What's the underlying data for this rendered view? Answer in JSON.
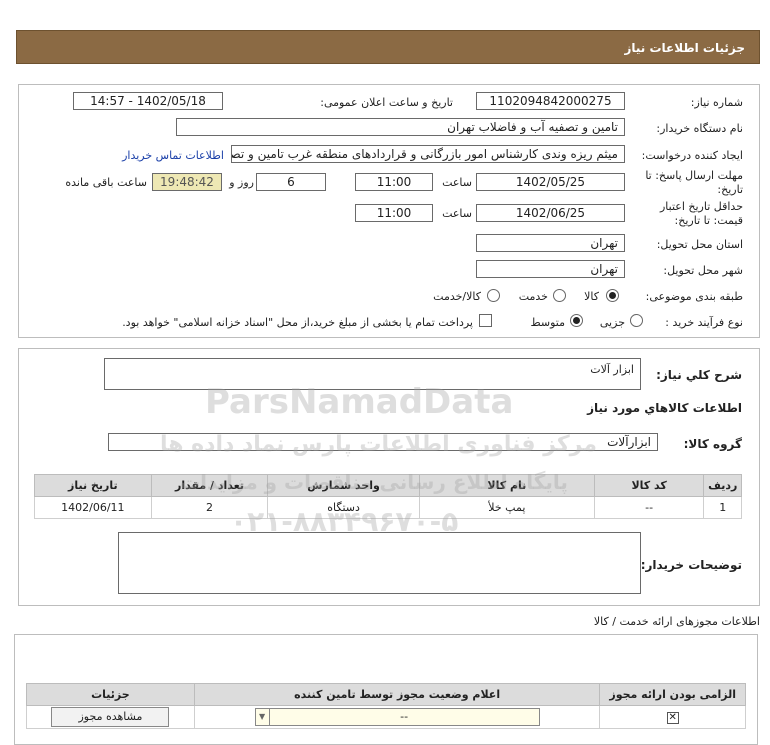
{
  "header": {
    "title": "جزئیات اطلاعات نیاز"
  },
  "form": {
    "need_number_label": "شماره نیاز:",
    "need_number": "1102094842000275",
    "announce_label": "تاریخ و ساعت اعلان عمومی:",
    "announce_value": "1402/05/18 - 14:57",
    "buyer_org_label": "نام دستگاه خریدار:",
    "buyer_org": "تامین و تصفیه آب و فاضلاب تهران",
    "creator_label": "ایجاد کننده درخواست:",
    "creator": "میثم ریزه وندی کارشناس امور بازرگانی و قراردادهای منطقه غرب تامین و تصفیه",
    "contact_link": "اطلاعات تماس خریدار",
    "deadline_label_1": "مهلت ارسال پاسخ: تا",
    "deadline_label_2": "تاریخ:",
    "deadline_date": "1402/05/25",
    "time_label": "ساعت",
    "deadline_time": "11:00",
    "days_value": "6",
    "days_label": "روز و",
    "remaining_time": "19:48:42",
    "remaining_label": "ساعت باقی مانده",
    "validity_label_1": "حداقل تاریخ اعتبار",
    "validity_label_2": "قیمت: تا تاریخ:",
    "validity_date": "1402/06/25",
    "validity_time": "11:00",
    "province_label": "استان محل تحویل:",
    "province": "تهران",
    "city_label": "شهر محل تحویل:",
    "city": "تهران",
    "category_label": "طبقه بندی موضوعی:",
    "category_options": [
      "کالا",
      "خدمت",
      "کالا/خدمت"
    ],
    "category_selected": "کالا",
    "process_label": "نوع فرآیند خرید :",
    "process_options": [
      "جزیی",
      "متوسط"
    ],
    "process_selected": "متوسط",
    "payment_note": "پرداخت تمام یا بخشی از مبلغ خرید،از محل \"اسناد خزانه اسلامی\" خواهد بود."
  },
  "needs": {
    "summary_label": "شرح کلي نياز:",
    "summary": "ابزار آلات",
    "goods_info_title": "اطلاعات کالاهاي مورد نياز",
    "goods_group_label": "گروه کالا:",
    "goods_group": "ابزارآلات",
    "table_headers": [
      "ردیف",
      "کد کالا",
      "نام کالا",
      "واحد شمارش",
      "تعداد / مقدار",
      "تاریخ نیاز"
    ],
    "rows": [
      [
        "1",
        "--",
        "پمپ خلأ",
        "دستگاه",
        "2",
        "1402/06/11"
      ]
    ],
    "buyer_notes_label": "توضیحات خریدار:",
    "buyer_notes": ""
  },
  "permits": {
    "title": "اطلاعات مجوزهای ارائه خدمت / کالا",
    "headers": [
      "الزامی بودن ارائه مجوز",
      "اعلام وضعیت مجوز توسط تامین کننده",
      "جزئیات"
    ],
    "select_value": "--",
    "view_button": "مشاهده مجوز"
  },
  "watermark": {
    "brand": "ParsNamadData",
    "line1": "مرکز فناوری اطلاعات پارس نماد داده ها",
    "line2": "پایگاه اطلاع رسانی مناقصات و مزایدات",
    "phone": "۰۲۱-۸۸۳۴۹۶۷۰-۵"
  }
}
